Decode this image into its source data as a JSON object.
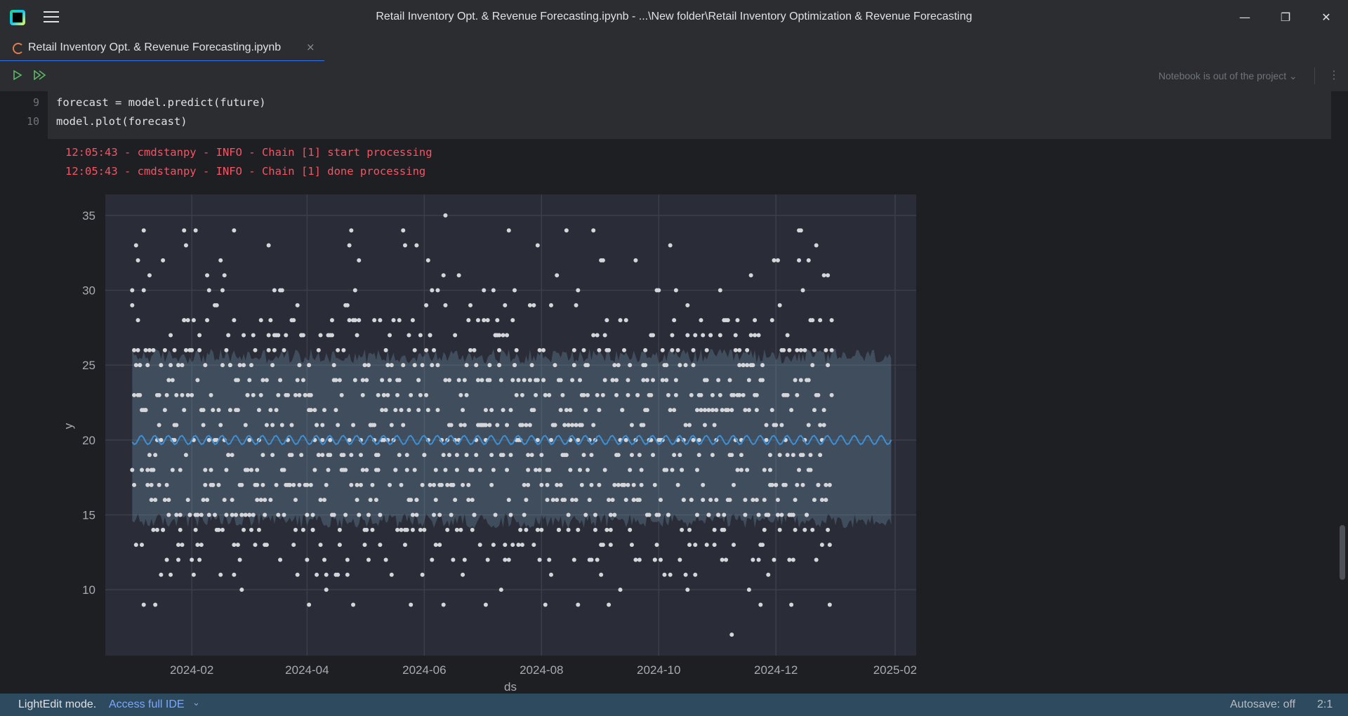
{
  "window": {
    "title": "Retail Inventory Opt. & Revenue Forecasting.ipynb - ...\\New folder\\Retail Inventory Optimization & Revenue Forecasting",
    "minimize": "—",
    "restore": "❐",
    "close": "✕"
  },
  "tab": {
    "label": "Retail Inventory Opt. & Revenue Forecasting.ipynb",
    "close": "×"
  },
  "toolbar": {
    "project_status": "Notebook is out of the project ⌄",
    "more": "⋮"
  },
  "code": {
    "lines": [
      {
        "number": "9",
        "text": "forecast = model.predict(future)"
      },
      {
        "number": "10",
        "text": "model.plot(forecast)"
      }
    ]
  },
  "output": {
    "log": [
      "12:05:43 - cmdstanpy - INFO - Chain [1] start processing",
      "12:05:43 - cmdstanpy - INFO - Chain [1] done processing"
    ]
  },
  "chart_data": {
    "type": "scatter",
    "title": "",
    "xlabel": "ds",
    "ylabel": "y",
    "x_range": [
      "2023-12-18",
      "2025-02-12"
    ],
    "ylim": [
      5.6,
      36.4
    ],
    "x_ticks": [
      "2024-02",
      "2024-04",
      "2024-06",
      "2024-08",
      "2024-10",
      "2024-12",
      "2025-02"
    ],
    "x_tick_dates": [
      "2024-02-01",
      "2024-04-01",
      "2024-06-01",
      "2024-08-01",
      "2024-10-01",
      "2024-12-01",
      "2025-02-01"
    ],
    "y_ticks": [
      10,
      15,
      20,
      25,
      30,
      35
    ],
    "grid": true,
    "history_range": [
      "2024-01-01",
      "2024-12-30"
    ],
    "forecast_range": [
      "2024-01-01",
      "2025-01-30"
    ],
    "forecast_yhat": 20.0,
    "forecast_upper": 25.6,
    "forecast_lower": 14.6,
    "y_levels": [
      9,
      10,
      11,
      12,
      13,
      14,
      15,
      16,
      17,
      18,
      19,
      20,
      21,
      22,
      23,
      24,
      25,
      26,
      27,
      28,
      29,
      30,
      31,
      32,
      33,
      34
    ],
    "y_level_weights": [
      2,
      2,
      4,
      7,
      12,
      14,
      18,
      18,
      18,
      18,
      18,
      18,
      18,
      18,
      18,
      18,
      18,
      14,
      12,
      7,
      5,
      4,
      3,
      2,
      2,
      1
    ],
    "outliers": [
      {
        "x": "2024-06-12",
        "y": 35
      },
      {
        "x": "2024-11-08",
        "y": 7
      },
      {
        "x": "2024-01-28",
        "y": 34
      },
      {
        "x": "2024-02-23",
        "y": 34
      },
      {
        "x": "2024-12-14",
        "y": 34
      },
      {
        "x": "2024-01-04",
        "y": 32
      },
      {
        "x": "2024-12-18",
        "y": 32
      },
      {
        "x": "2024-05-28",
        "y": 33
      },
      {
        "x": "2024-07-30",
        "y": 33
      },
      {
        "x": "2024-01-07",
        "y": 9
      },
      {
        "x": "2024-04-02",
        "y": 9
      },
      {
        "x": "2024-07-03",
        "y": 9
      },
      {
        "x": "2024-08-20",
        "y": 9
      }
    ],
    "colors": {
      "background": "#2a2c37",
      "grid": "#3c3f4a",
      "points": "#d4d6da",
      "line": "#3d8fd6",
      "band": "rgba(120,165,190,0.28)",
      "text": "#a9abb2"
    }
  },
  "status": {
    "mode": "LightEdit mode.",
    "link": "Access full IDE",
    "link_chevron": "⌄",
    "autosave": "Autosave: off",
    "position": "2:1"
  }
}
